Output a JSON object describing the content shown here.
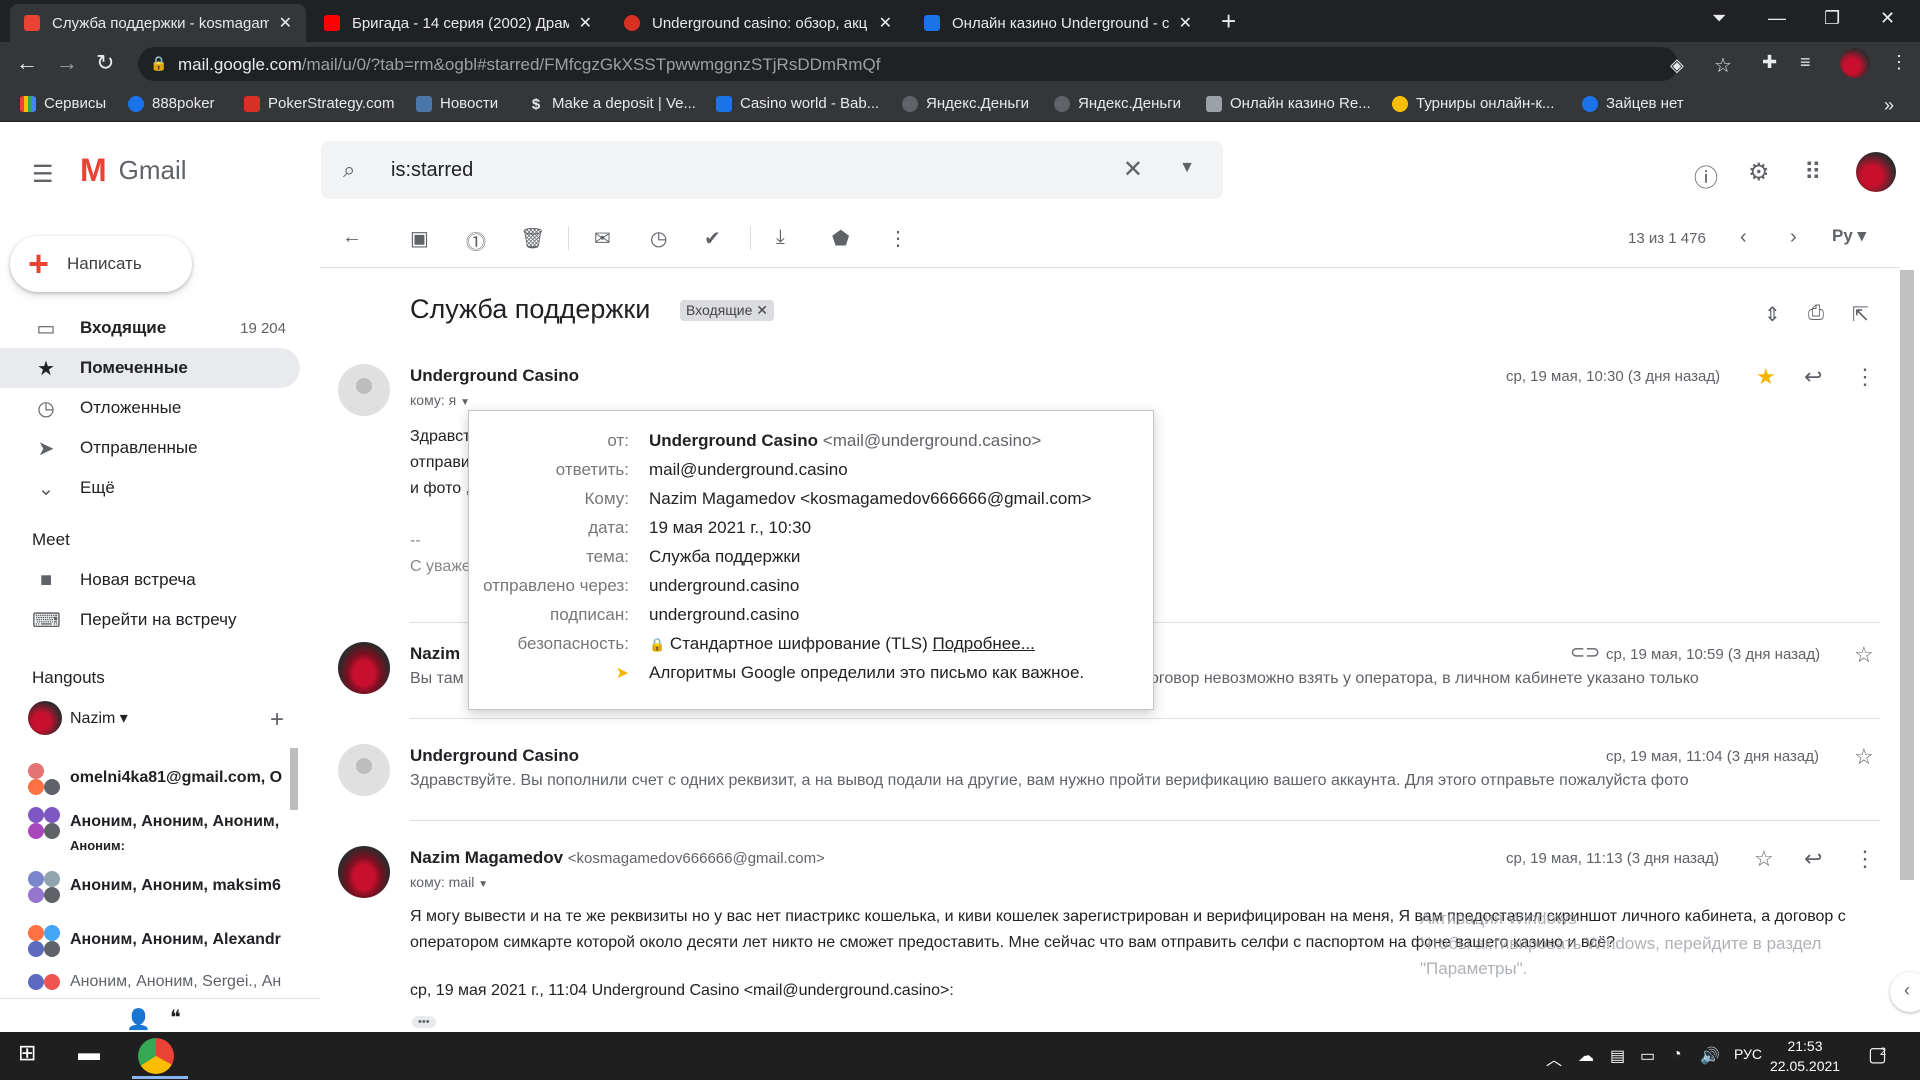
{
  "browser": {
    "tabs": [
      {
        "title": "Служба поддержки - kosmagam",
        "color": "#ea4335"
      },
      {
        "title": "Бригада - 14 серия (2002) Драм",
        "color": "#ff0000"
      },
      {
        "title": "Underground casino: обзор, акц",
        "color": "#d93025"
      },
      {
        "title": "Онлайн казино Underground - с",
        "color": "#1a73e8"
      }
    ],
    "url_host": "mail.google.com",
    "url_path": "/mail/u/0/?tab=rm&ogbl#starred/FMfcgzGkXSSTpwwmggnzSTjRsDDmRmQf",
    "bookmarks": [
      "Сервисы",
      "888poker",
      "PokerStrategy.com",
      "Новости",
      "Make a deposit | Ve...",
      "Casino world - Bab...",
      "Яндекс.Деньги",
      "Яндекс.Деньги",
      "Онлайн казино Re...",
      "Турниры онлайн-к...",
      "Зайцев нет"
    ]
  },
  "gmail": {
    "logo_text": "Gmail",
    "search_value": "is:starred",
    "compose_label": "Написать",
    "nav": [
      {
        "icon": "inbox-icon",
        "label": "Входящие",
        "count": "19 204"
      },
      {
        "icon": "star-icon",
        "label": "Помеченные",
        "count": ""
      },
      {
        "icon": "clock-icon",
        "label": "Отложенные",
        "count": ""
      },
      {
        "icon": "send-icon",
        "label": "Отправленные",
        "count": ""
      },
      {
        "icon": "chevron-down-icon",
        "label": "Ещё",
        "count": ""
      }
    ],
    "meet_title": "Meet",
    "meet_items": [
      "Новая встреча",
      "Перейти на встречу"
    ],
    "hangouts_title": "Hangouts",
    "hangouts_user": "Nazim",
    "hangouts": [
      "omelni4ka81@gmail.com, O",
      "Аноним, Аноним, Аноним,",
      "Аноним, Аноним, maksim6",
      "Аноним, Аноним, Alexandr",
      "Аноним, Аноним, Sergei., Ан"
    ],
    "hangouts_sub": "Аноним:",
    "pager": "13 из 1 476",
    "lang_btn": "Ру",
    "subject": "Служба поддержки",
    "label": "Входящие",
    "messages": [
      {
        "sender": "Underground Casino",
        "to": "кому: я",
        "date": "ср, 19 мая, 10:30 (3 дня назад)",
        "lines": [
          "Здравст",
          "отправи",
          "и фото ,",
          "--",
          "С уваже"
        ]
      },
      {
        "sender": "Nazim",
        "snippet": "Вы там",
        "snippet_tail": "оговор невозможно взять у оператора, в личном кабинете указано только",
        "date": "ср, 19 мая, 10:59 (3 дня назад)"
      },
      {
        "sender": "Underground Casino",
        "snippet": "Здравствуйте. Вы пополнили счет с одних реквизит, а на вывод подали на другие, вам нужно пройти верификацию вашего аккаунта. Для этого отправьте пожалуйста фото",
        "date": "ср, 19 мая, 11:04 (3 дня назад)"
      },
      {
        "sender": "Nazim Magamedov",
        "email": "<kosmagamedov666666@gmail.com>",
        "to": "кому: mail",
        "date": "ср, 19 мая, 11:13 (3 дня назад)",
        "body1": "Я могу вывести и на те же реквизиты но у вас нет пиастрикс кошелька, и киви кошелек зарегистрирован и верифицирован на меня, Я вам предоставил скриншот личного кабинета, а договор с",
        "body2": "оператором симкарте которой около десяти лет никто не сможет предоставить. Мне сейчас что вам отправить селфи с паспортом на фоне вашего казино и всё?",
        "quote": "ср, 19 мая 2021 г., 11:04 Underground Casino <mail@underground.casino>:",
        "ellipsis": "•••"
      }
    ],
    "popup": {
      "rows": [
        {
          "k": "от:",
          "v": "Underground Casino",
          "v2": " <mail@underground.casino>"
        },
        {
          "k": "ответить:",
          "v": "mail@underground.casino"
        },
        {
          "k": "Кому:",
          "v": "Nazim Magamedov <kosmagamedov666666@gmail.com>"
        },
        {
          "k": "дата:",
          "v": "19 мая 2021 г., 10:30"
        },
        {
          "k": "тема:",
          "v": "Служба поддержки"
        },
        {
          "k": "отправлено через:",
          "v": "underground.casino"
        },
        {
          "k": "подписан:",
          "v": "underground.casino"
        },
        {
          "k": "безопасность:",
          "v": "Стандартное шифрование (TLS)",
          "link": "Подробнее..."
        },
        {
          "k": "",
          "v": "Алгоритмы Google определили это письмо как важное."
        }
      ]
    },
    "watermark": [
      "Активация Windows",
      "Чтобы активировать Windows, перейдите в раздел",
      "\"Параметры\"."
    ]
  },
  "taskbar": {
    "lang": "РУС",
    "time": "21:53",
    "date": "22.05.2021",
    "notif_count": "2"
  },
  "colors": {
    "accent": "#1a73e8",
    "star": "#f4b400",
    "selected_nav": "#e8eaed"
  }
}
